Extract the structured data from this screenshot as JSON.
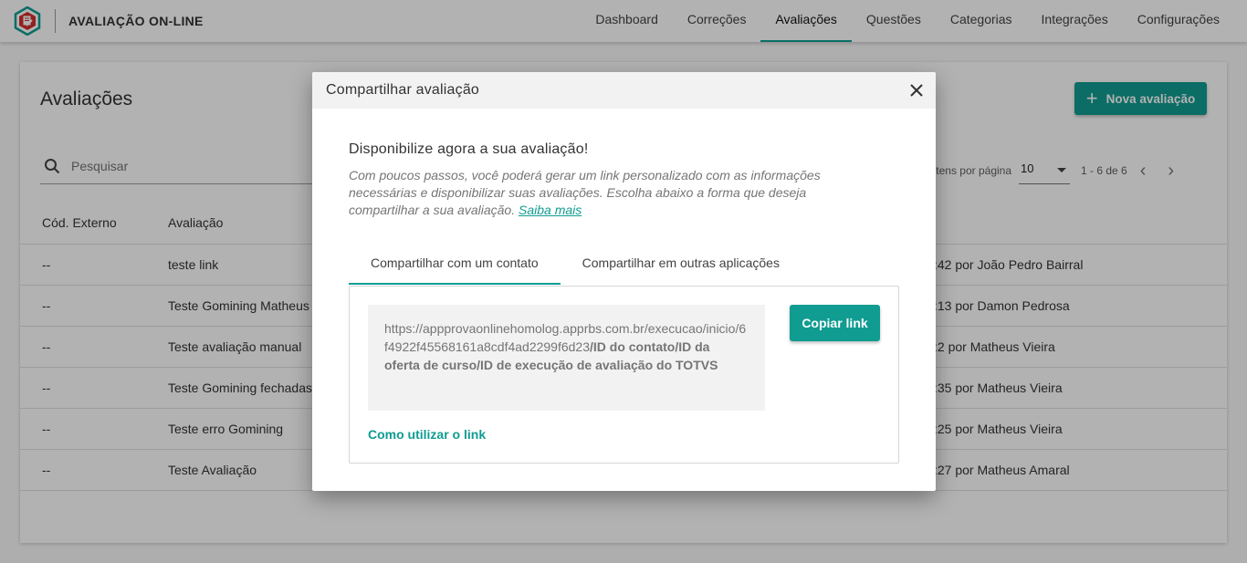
{
  "header": {
    "app_title": "AVALIAÇÃO ON-LINE",
    "nav": [
      {
        "label": "Dashboard",
        "active": false
      },
      {
        "label": "Correções",
        "active": false
      },
      {
        "label": "Avaliações",
        "active": true
      },
      {
        "label": "Questões",
        "active": false
      },
      {
        "label": "Categorias",
        "active": false
      },
      {
        "label": "Integrações",
        "active": false
      },
      {
        "label": "Configurações",
        "active": false
      }
    ]
  },
  "main": {
    "title": "Avaliações",
    "new_button_label": "Nova avaliação",
    "search_placeholder": "Pesquisar",
    "pagination": {
      "per_page_label": "Itens por página",
      "per_page_value": "10",
      "range": "1 - 6 de 6"
    },
    "table": {
      "columns": [
        "Cód. Externo",
        "Avaliação"
      ],
      "rows": [
        {
          "code": "--",
          "name": "teste link",
          "updated": ":42 por João Pedro Bairral"
        },
        {
          "code": "--",
          "name": "Teste Gomining Matheus",
          "updated": ":13 por Damon Pedrosa"
        },
        {
          "code": "--",
          "name": "Teste avaliação manual",
          "updated": ":2 por Matheus Vieira"
        },
        {
          "code": "--",
          "name": "Teste Gomining fechadas",
          "updated": ":35 por Matheus Vieira"
        },
        {
          "code": "--",
          "name": "Teste erro Gomining",
          "updated": ":25 por Matheus Vieira"
        },
        {
          "code": "--",
          "name": "Teste Avaliação",
          "updated": ":27 por Matheus Amaral"
        }
      ]
    }
  },
  "dialog": {
    "title": "Compartilhar avaliação",
    "heading": "Disponibilize agora a sua avaliação!",
    "description": "Com poucos passos, você poderá gerar um link personalizado com as informações necessárias e disponibilizar suas avaliações. Escolha abaixo a forma que deseja compartilhar a sua avaliação.",
    "learn_more": "Saiba mais",
    "tabs": [
      {
        "label": "Compartilhar com um contato",
        "active": true
      },
      {
        "label": "Compartilhar em outras aplicações",
        "active": false
      }
    ],
    "link_base": "https://appprovaonlinehomolog.apprbs.com.br/execucao/inicio/6f4922f45568161a8cdf4ad2299f6d23",
    "link_params": "/ID do contato/ID da oferta de curso/ID de execução de avaliação do TOTVS",
    "copy_button": "Copiar link",
    "how_to": "Como utilizar o link"
  },
  "colors": {
    "accent": "#109c91",
    "logo_red": "#d32f2f"
  }
}
